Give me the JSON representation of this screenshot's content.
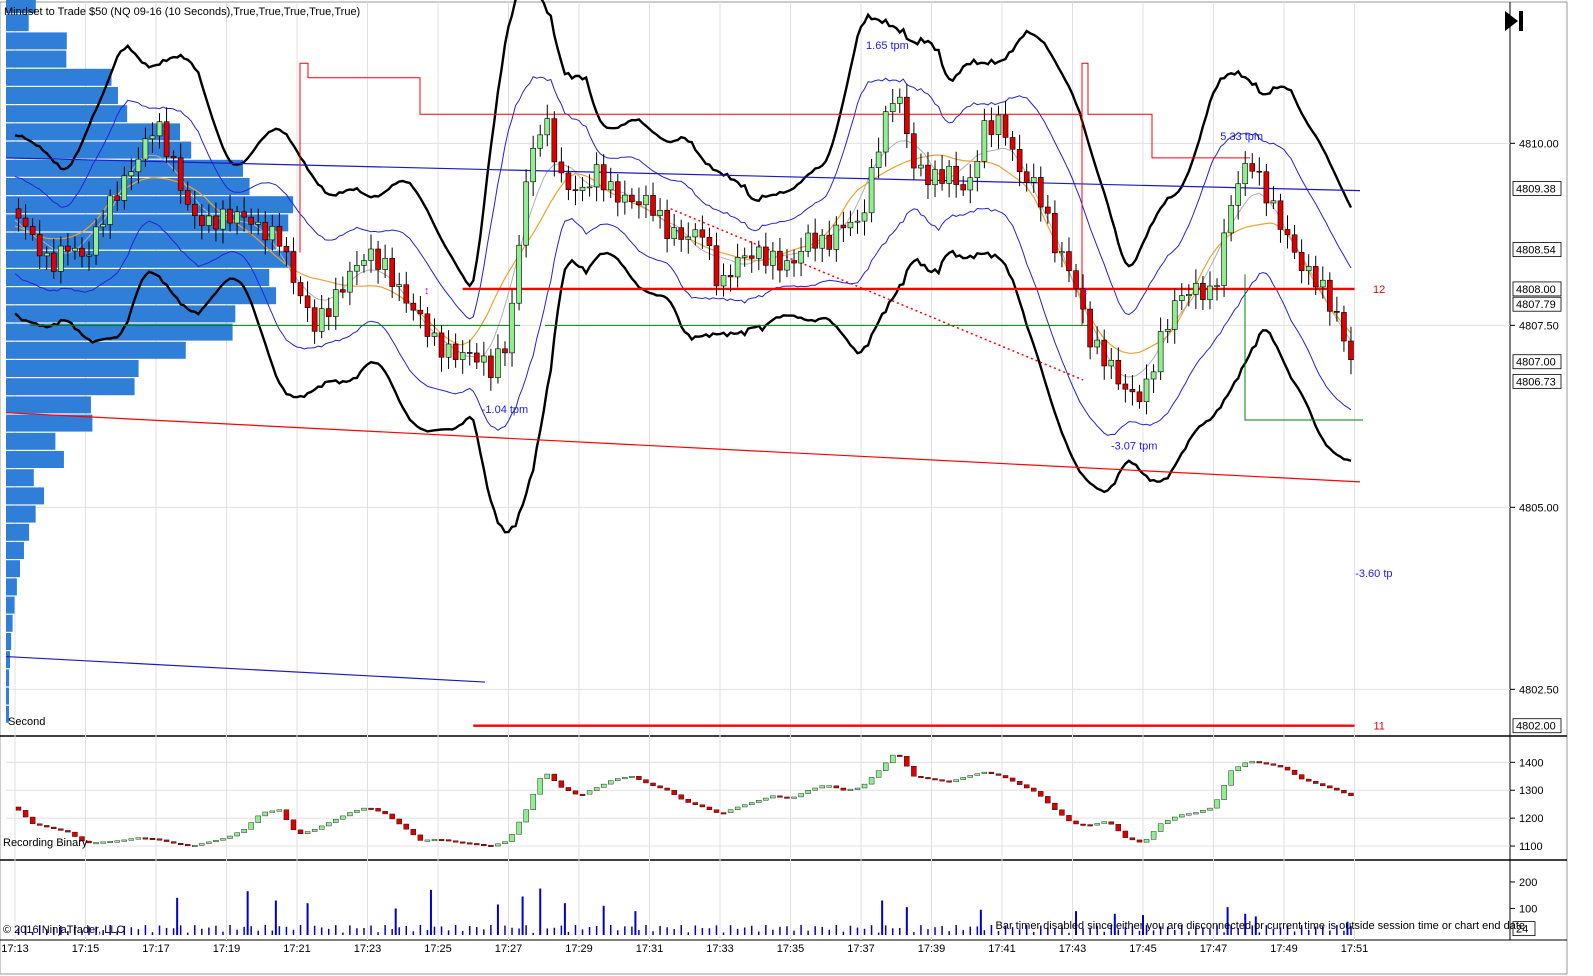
{
  "header": {
    "title": "Mindset to Trade  $50   (NQ 09-16 (10 Seconds),True,True,True,True,True)"
  },
  "colors": {
    "up": "#90ee90",
    "down": "#dd0000",
    "profile": "#2f7fd8",
    "band": "#000000",
    "inner_band": "#2222dd",
    "orange": "#f0a030",
    "gray": "#b0b0b0",
    "red_line": "#ff0000",
    "green_line": "#008000",
    "blue_text": "#1a1aff",
    "grid": "#e0e0e0"
  },
  "icons": {
    "play_end": "skip-to-end-icon"
  },
  "chart_data": [
    {
      "type": "candlestick",
      "name": "price-panel",
      "ylim": [
        4801.9,
        4811.9
      ],
      "y_ticks": [
        "4810.00",
        "4807.50",
        "4805.00",
        "4802.50"
      ],
      "price_markers": [
        "4809.38",
        "4808.54",
        "4808.00",
        "4807.79",
        "4807.00",
        "4806.73",
        "4802.00"
      ],
      "x_ticks": [
        "17:13",
        "17:15",
        "17:17",
        "17:19",
        "17:21",
        "17:23",
        "17:25",
        "17:27",
        "17:29",
        "17:31",
        "17:33",
        "17:35",
        "17:37",
        "17:39",
        "17:41",
        "17:43",
        "17:45",
        "17:47",
        "17:49",
        "17:51"
      ],
      "annotations": [
        {
          "text": "1.65 tpm",
          "t": 37.75,
          "v": 4811.35
        },
        {
          "text": "5.33 tpm",
          "t": 47.8,
          "v": 4810.1
        },
        {
          "text": "-1.04 tpm",
          "t": 26.9,
          "v": 4806.35
        },
        {
          "text": "-3.07 tpm",
          "t": 44.75,
          "v": 4805.85
        },
        {
          "text": "-3.60 tp",
          "t": 51.55,
          "v": 4804.1
        },
        {
          "text": "12",
          "t": 51.7,
          "v": 4808.0
        },
        {
          "text": "11",
          "t": 51.7,
          "v": 4802.0
        }
      ],
      "levels": [
        {
          "name": "red-level-12",
          "value": 4808.0,
          "from": 25.7,
          "to": 51.0
        },
        {
          "name": "red-level-11",
          "value": 4802.0,
          "from": 26.0,
          "to": 51.0
        }
      ],
      "price_series": [
        {
          "t": 13.0,
          "v": 4809.1
        },
        {
          "t": 13.5,
          "v": 4808.7
        },
        {
          "t": 14.0,
          "v": 4808.3
        },
        {
          "t": 14.5,
          "v": 4808.6
        },
        {
          "t": 15.0,
          "v": 4808.4
        },
        {
          "t": 15.5,
          "v": 4809.0
        },
        {
          "t": 16.0,
          "v": 4809.4
        },
        {
          "t": 16.5,
          "v": 4809.8
        },
        {
          "t": 17.0,
          "v": 4810.3
        },
        {
          "t": 17.5,
          "v": 4809.7
        },
        {
          "t": 18.0,
          "v": 4809.0
        },
        {
          "t": 18.5,
          "v": 4808.9
        },
        {
          "t": 19.0,
          "v": 4809.0
        },
        {
          "t": 19.5,
          "v": 4809.0
        },
        {
          "t": 20.0,
          "v": 4808.8
        },
        {
          "t": 20.5,
          "v": 4808.7
        },
        {
          "t": 21.0,
          "v": 4808.0
        },
        {
          "t": 21.5,
          "v": 4807.5
        },
        {
          "t": 22.0,
          "v": 4807.8
        },
        {
          "t": 22.5,
          "v": 4808.2
        },
        {
          "t": 23.0,
          "v": 4808.5
        },
        {
          "t": 23.5,
          "v": 4808.3
        },
        {
          "t": 24.0,
          "v": 4807.9
        },
        {
          "t": 24.5,
          "v": 4807.6
        },
        {
          "t": 25.0,
          "v": 4807.2
        },
        {
          "t": 25.5,
          "v": 4807.1
        },
        {
          "t": 26.0,
          "v": 4807.1
        },
        {
          "t": 26.5,
          "v": 4806.9
        },
        {
          "t": 27.0,
          "v": 4807.3
        },
        {
          "t": 27.5,
          "v": 4809.5
        },
        {
          "t": 28.0,
          "v": 4810.4
        },
        {
          "t": 28.5,
          "v": 4809.5
        },
        {
          "t": 29.0,
          "v": 4809.3
        },
        {
          "t": 29.5,
          "v": 4809.6
        },
        {
          "t": 30.0,
          "v": 4809.3
        },
        {
          "t": 30.5,
          "v": 4809.2
        },
        {
          "t": 31.0,
          "v": 4809.2
        },
        {
          "t": 31.5,
          "v": 4808.8
        },
        {
          "t": 32.0,
          "v": 4808.7
        },
        {
          "t": 32.5,
          "v": 4808.8
        },
        {
          "t": 33.0,
          "v": 4808.0
        },
        {
          "t": 33.5,
          "v": 4808.4
        },
        {
          "t": 34.0,
          "v": 4808.5
        },
        {
          "t": 34.5,
          "v": 4808.4
        },
        {
          "t": 35.0,
          "v": 4808.3
        },
        {
          "t": 35.5,
          "v": 4808.7
        },
        {
          "t": 36.0,
          "v": 4808.6
        },
        {
          "t": 36.5,
          "v": 4808.9
        },
        {
          "t": 37.0,
          "v": 4808.9
        },
        {
          "t": 37.5,
          "v": 4810.0
        },
        {
          "t": 38.0,
          "v": 4810.8
        },
        {
          "t": 38.5,
          "v": 4809.7
        },
        {
          "t": 39.0,
          "v": 4809.5
        },
        {
          "t": 39.5,
          "v": 4809.6
        },
        {
          "t": 40.0,
          "v": 4809.3
        },
        {
          "t": 40.5,
          "v": 4810.2
        },
        {
          "t": 41.0,
          "v": 4810.3
        },
        {
          "t": 41.5,
          "v": 4809.6
        },
        {
          "t": 42.0,
          "v": 4809.4
        },
        {
          "t": 42.5,
          "v": 4808.6
        },
        {
          "t": 43.0,
          "v": 4808.2
        },
        {
          "t": 43.5,
          "v": 4807.3
        },
        {
          "t": 44.0,
          "v": 4807.0
        },
        {
          "t": 44.5,
          "v": 4806.6
        },
        {
          "t": 45.0,
          "v": 4806.5
        },
        {
          "t": 45.5,
          "v": 4807.3
        },
        {
          "t": 46.0,
          "v": 4807.9
        },
        {
          "t": 46.5,
          "v": 4808.0
        },
        {
          "t": 47.0,
          "v": 4807.9
        },
        {
          "t": 47.5,
          "v": 4809.2
        },
        {
          "t": 48.0,
          "v": 4809.8
        },
        {
          "t": 48.5,
          "v": 4809.3
        },
        {
          "t": 49.0,
          "v": 4808.8
        },
        {
          "t": 49.5,
          "v": 4808.3
        },
        {
          "t": 50.0,
          "v": 4808.1
        },
        {
          "t": 50.5,
          "v": 4807.6
        },
        {
          "t": 51.0,
          "v": 4806.9
        }
      ]
    },
    {
      "type": "line",
      "name": "indicator-panel",
      "title": "Recording Binary",
      "ylim": [
        1050,
        1480
      ],
      "y_ticks": [
        1400,
        1300,
        1200,
        1100
      ],
      "values": [
        {
          "t": 13.0,
          "v": 1240
        },
        {
          "t": 13.5,
          "v": 1180
        },
        {
          "t": 14.0,
          "v": 1165
        },
        {
          "t": 14.5,
          "v": 1150
        },
        {
          "t": 15.0,
          "v": 1110
        },
        {
          "t": 15.5,
          "v": 1115
        },
        {
          "t": 16.0,
          "v": 1120
        },
        {
          "t": 16.5,
          "v": 1130
        },
        {
          "t": 17.0,
          "v": 1125
        },
        {
          "t": 17.5,
          "v": 1110
        },
        {
          "t": 18.0,
          "v": 1100
        },
        {
          "t": 18.5,
          "v": 1115
        },
        {
          "t": 19.0,
          "v": 1130
        },
        {
          "t": 19.5,
          "v": 1160
        },
        {
          "t": 20.0,
          "v": 1220
        },
        {
          "t": 20.5,
          "v": 1230
        },
        {
          "t": 21.0,
          "v": 1140
        },
        {
          "t": 21.5,
          "v": 1160
        },
        {
          "t": 22.0,
          "v": 1190
        },
        {
          "t": 22.5,
          "v": 1220
        },
        {
          "t": 23.0,
          "v": 1240
        },
        {
          "t": 23.5,
          "v": 1215
        },
        {
          "t": 24.0,
          "v": 1170
        },
        {
          "t": 24.5,
          "v": 1120
        },
        {
          "t": 25.0,
          "v": 1125
        },
        {
          "t": 25.5,
          "v": 1115
        },
        {
          "t": 26.0,
          "v": 1108
        },
        {
          "t": 26.5,
          "v": 1100
        },
        {
          "t": 27.0,
          "v": 1120
        },
        {
          "t": 27.5,
          "v": 1230
        },
        {
          "t": 28.0,
          "v": 1370
        },
        {
          "t": 28.5,
          "v": 1310
        },
        {
          "t": 29.0,
          "v": 1280
        },
        {
          "t": 29.5,
          "v": 1310
        },
        {
          "t": 30.0,
          "v": 1340
        },
        {
          "t": 30.5,
          "v": 1350
        },
        {
          "t": 31.0,
          "v": 1320
        },
        {
          "t": 31.5,
          "v": 1300
        },
        {
          "t": 32.0,
          "v": 1260
        },
        {
          "t": 32.5,
          "v": 1240
        },
        {
          "t": 33.0,
          "v": 1215
        },
        {
          "t": 33.5,
          "v": 1240
        },
        {
          "t": 34.0,
          "v": 1260
        },
        {
          "t": 34.5,
          "v": 1280
        },
        {
          "t": 35.0,
          "v": 1270
        },
        {
          "t": 35.5,
          "v": 1300
        },
        {
          "t": 36.0,
          "v": 1320
        },
        {
          "t": 36.5,
          "v": 1300
        },
        {
          "t": 37.0,
          "v": 1310
        },
        {
          "t": 37.5,
          "v": 1370
        },
        {
          "t": 38.0,
          "v": 1440
        },
        {
          "t": 38.5,
          "v": 1350
        },
        {
          "t": 39.0,
          "v": 1340
        },
        {
          "t": 39.5,
          "v": 1330
        },
        {
          "t": 40.0,
          "v": 1350
        },
        {
          "t": 40.5,
          "v": 1365
        },
        {
          "t": 41.0,
          "v": 1350
        },
        {
          "t": 41.5,
          "v": 1320
        },
        {
          "t": 42.0,
          "v": 1290
        },
        {
          "t": 42.5,
          "v": 1230
        },
        {
          "t": 43.0,
          "v": 1180
        },
        {
          "t": 43.5,
          "v": 1175
        },
        {
          "t": 44.0,
          "v": 1190
        },
        {
          "t": 44.5,
          "v": 1130
        },
        {
          "t": 45.0,
          "v": 1110
        },
        {
          "t": 45.5,
          "v": 1180
        },
        {
          "t": 46.0,
          "v": 1210
        },
        {
          "t": 46.5,
          "v": 1220
        },
        {
          "t": 47.0,
          "v": 1240
        },
        {
          "t": 47.5,
          "v": 1370
        },
        {
          "t": 48.0,
          "v": 1405
        },
        {
          "t": 48.5,
          "v": 1395
        },
        {
          "t": 49.0,
          "v": 1380
        },
        {
          "t": 49.5,
          "v": 1340
        },
        {
          "t": 50.0,
          "v": 1320
        },
        {
          "t": 50.5,
          "v": 1300
        },
        {
          "t": 51.0,
          "v": 1275
        }
      ]
    },
    {
      "type": "bar",
      "name": "volume-panel",
      "ylim": [
        0,
        260
      ],
      "y_ticks": [
        200,
        100
      ],
      "last_value": "24",
      "volume_spikes": [
        {
          "t": 17.6,
          "v": 140
        },
        {
          "t": 19.6,
          "v": 165
        },
        {
          "t": 20.4,
          "v": 130
        },
        {
          "t": 21.3,
          "v": 120
        },
        {
          "t": 23.8,
          "v": 100
        },
        {
          "t": 24.8,
          "v": 170
        },
        {
          "t": 26.7,
          "v": 115
        },
        {
          "t": 27.4,
          "v": 145
        },
        {
          "t": 27.9,
          "v": 175
        },
        {
          "t": 28.6,
          "v": 120
        },
        {
          "t": 29.7,
          "v": 110
        },
        {
          "t": 30.6,
          "v": 90
        },
        {
          "t": 37.6,
          "v": 130
        },
        {
          "t": 38.3,
          "v": 105
        },
        {
          "t": 40.4,
          "v": 95
        },
        {
          "t": 43.1,
          "v": 90
        },
        {
          "t": 44.2,
          "v": 80
        },
        {
          "t": 45.0,
          "v": 75
        },
        {
          "t": 47.4,
          "v": 105
        },
        {
          "t": 47.9,
          "v": 80
        },
        {
          "t": 48.2,
          "v": 70
        },
        {
          "t": 50.8,
          "v": 50
        }
      ]
    }
  ],
  "panels": {
    "second_label": "Second",
    "recording_label": "Recording Binary",
    "copyright": "© 2016 NinjaTrader, LLC",
    "bar_timer_msg": "Bar timer disabled since either you are disconnected or current time is outside session time or chart end date"
  }
}
